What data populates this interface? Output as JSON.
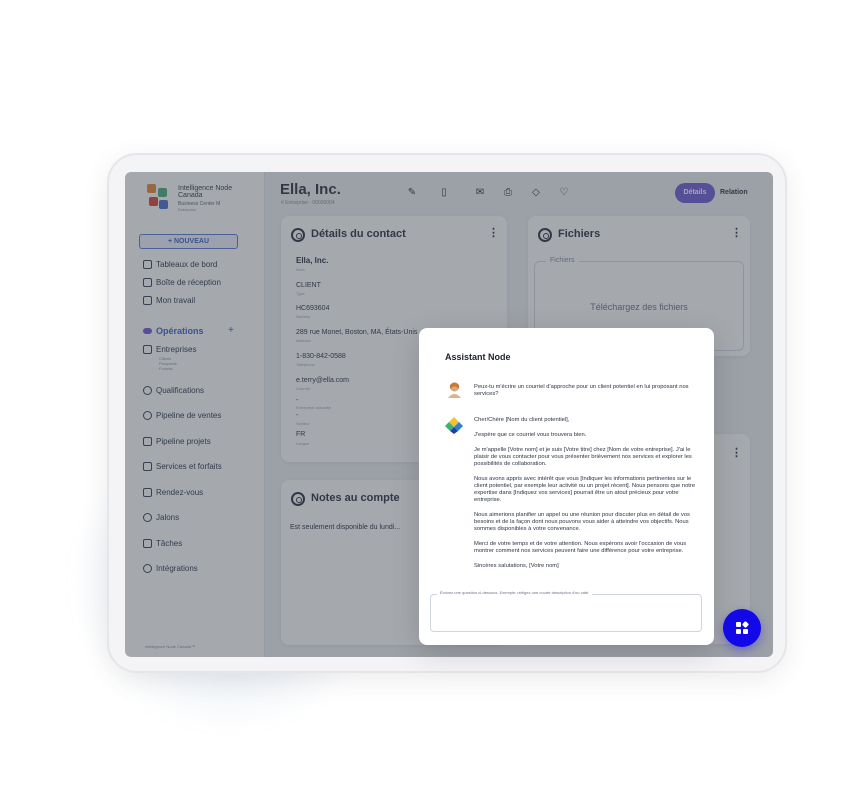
{
  "sidebar": {
    "org_name": "Intelligence Node Canada",
    "org_sub": "Business Center M",
    "org_sub2": "Entreprise",
    "new_button": "+ NOUVEAU",
    "nav": [
      "Tableaux de bord",
      "Boîte de réception",
      "Mon travail"
    ],
    "ops_label": "Opérations",
    "entreprises": "Entreprises",
    "entreprises_sub": [
      "Clients",
      "Prospects",
      "Fournis."
    ],
    "items": [
      "Qualifications",
      "Pipeline de ventes",
      "Pipeline projets",
      "Services et forfaits",
      "Rendez-vous",
      "Jalons",
      "Tâches",
      "Intégrations"
    ],
    "footer": "Intelligence Node Canada™"
  },
  "header": {
    "title": "Ella, Inc.",
    "breadcrumb": "#  Entreprise · 00000004",
    "tab_details": "Détails",
    "tab_relation": "Relation"
  },
  "contact_card": {
    "title": "Détails du contact",
    "fields": [
      {
        "value": "Ella, Inc.",
        "label": "Nom"
      },
      {
        "value": "CLIENT",
        "label": "Type"
      },
      {
        "value": "HC693604",
        "label": "Numéro"
      },
      {
        "value": "289 rue Monet, Boston, MA, États-Unis",
        "label": "Adresse"
      },
      {
        "value": "1-830-842-0588",
        "label": "Téléphone"
      },
      {
        "value": "e.terry@ella.com",
        "label": "Courriel"
      },
      {
        "value": "-",
        "label": "Entreprise associée"
      },
      {
        "value": "-",
        "label": "Secteur"
      },
      {
        "value": "FR",
        "label": "Langue"
      }
    ]
  },
  "notes_card": {
    "title": "Notes au compte",
    "text": "Est seulement disponible du lundi..."
  },
  "files_card": {
    "title": "Fichiers",
    "legend": "Fichiers",
    "upload": "Téléchargez des fichiers"
  },
  "assistant": {
    "title": "Assistant Node",
    "user_message": "Peux-tu m'écrire un courriel d'approche pour un client potentiel en lui proposant nos services?",
    "bot_paragraphs": [
      "Cher/Chère [Nom du client potentiel],",
      "J'espère que ce courriel vous trouvera bien.",
      "Je m'appelle [Votre nom] et je suis [Votre titre] chez [Nom de votre entreprise]. J'ai le plaisir de vous contacter pour vous présenter brièvement nos services et explorer les possibilités de collaboration.",
      "Nous avons appris avec intérêt que vous [Indiquer les informations pertinentes sur le client potentiel, par exemple leur activité ou un projet récent]. Nous pensons que notre expertise dans [Indiquez vos services] pourrait être un atout précieux pour votre entreprise.",
      "Nous aimerions planifier un appel ou une réunion pour discuter plus en détail de vos besoins et de la façon dont nous pouvons vous aider à atteindre vos objectifs. Nous sommes disponibles à votre convenance.",
      "Merci de votre temps et de votre attention. Nous espérons avoir l'occasion de vous montrer comment nos services peuvent faire une différence pour votre entreprise.",
      "Sincères salutations, [Votre nom]"
    ],
    "input_label": "Écrivez une question ci-dessous. Exemple: rédigez une courte description d'un café."
  },
  "colors": {
    "accent": "#6f5bd8",
    "fab": "#1208e8",
    "link": "#3d64c7"
  }
}
